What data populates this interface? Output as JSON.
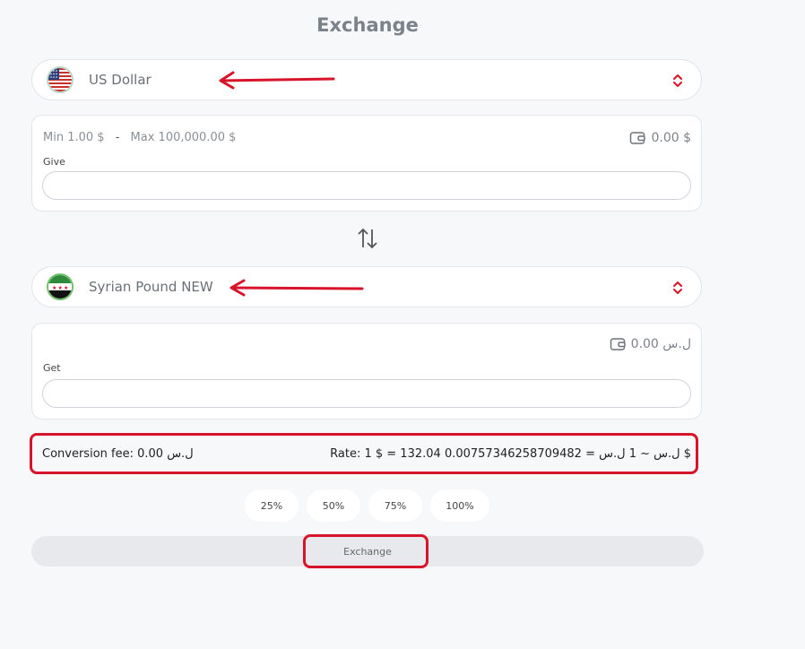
{
  "page": {
    "title": "Exchange"
  },
  "give_currency": {
    "name": "US Dollar",
    "flag_icon": "us-flag-icon"
  },
  "give": {
    "min": "Min 1.00 $",
    "separator": "-",
    "max": "Max 100,000.00 $",
    "balance": "0.00 $",
    "label": "Give",
    "value": ""
  },
  "get_currency": {
    "name": "Syrian Pound NEW",
    "flag_icon": "syria-independence-flag-icon"
  },
  "get": {
    "balance": "ل.س 0.00",
    "label": "Get",
    "value": ""
  },
  "info": {
    "conversion_fee": "Conversion fee: 0.00 ل.س",
    "rate": "Rate: 1 $ = 132.04 ل.س ~ 1 ل.س = 0.00757346258709482 $"
  },
  "percent_buttons": [
    "25%",
    "50%",
    "75%",
    "100%"
  ],
  "exchange_button": "Exchange",
  "colors": {
    "annotation_red": "#d8142a",
    "select_chevron": "#d8142a",
    "title_gray": "#7c828a"
  }
}
